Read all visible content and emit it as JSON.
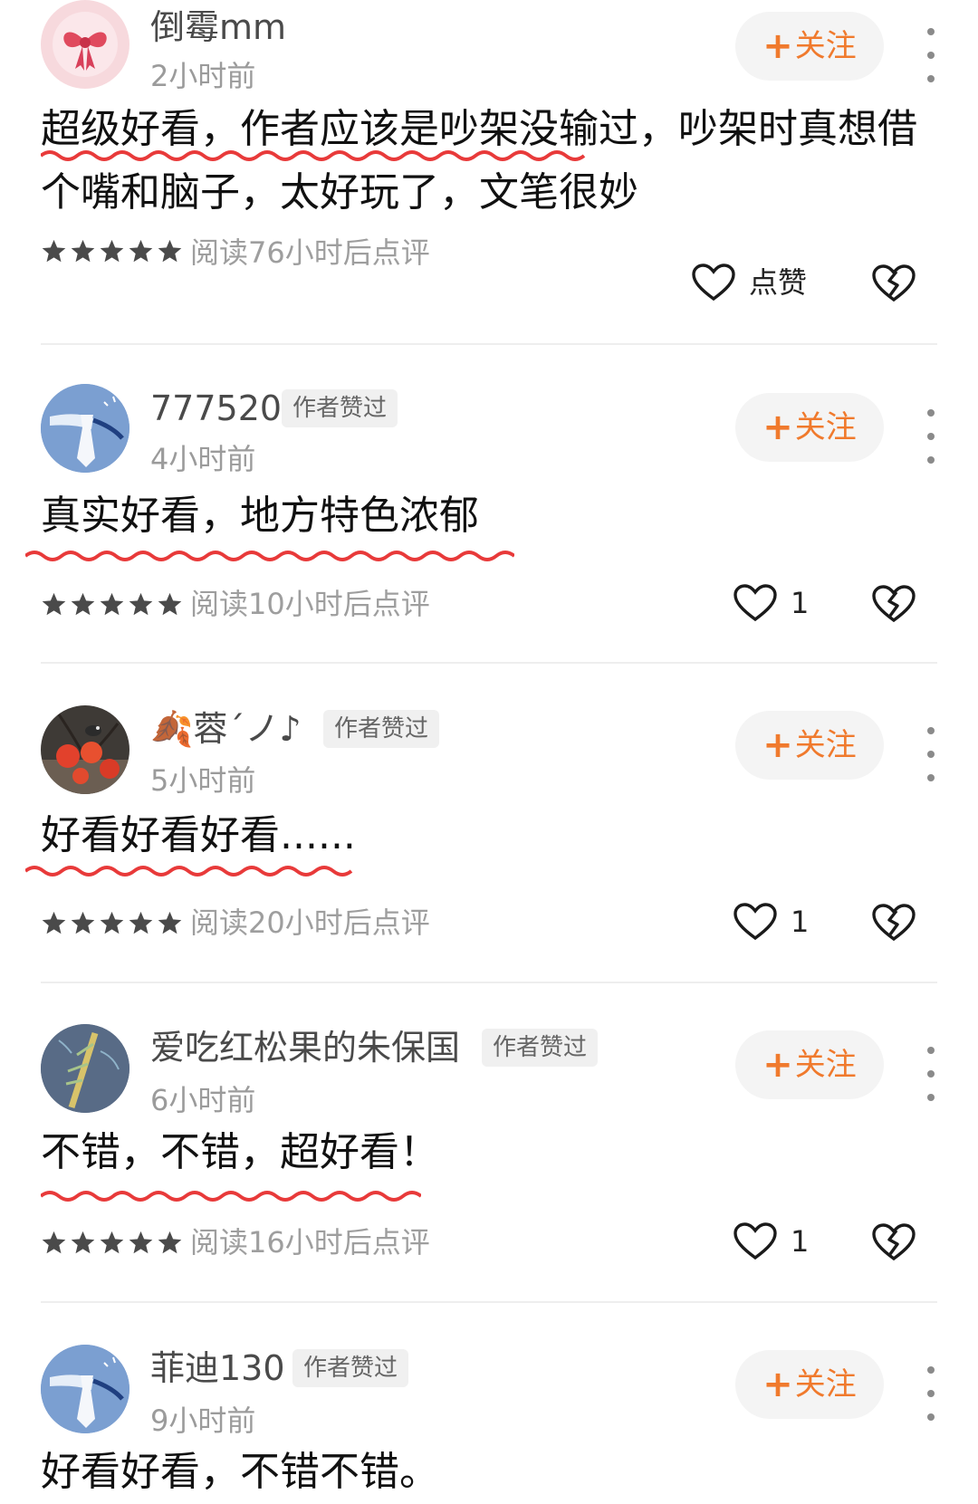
{
  "comments": [
    {
      "username": "倒霉mm",
      "time": "2小时前",
      "follow_label": "关注",
      "text_lines": [
        "超级好看，作者应该是吵架没输过，吵架时真想借",
        "个嘴和脑子，太好玩了，文笔很妙"
      ],
      "rating": 5,
      "read_time": "阅读76小时后点评",
      "like_label": "点赞",
      "avatar_icon": "bow-avatar-icon"
    },
    {
      "username": "777520",
      "badge": "作者赞过",
      "time": "4小时前",
      "follow_label": "关注",
      "text_lines": [
        "真实好看，地方特色浓郁"
      ],
      "rating": 5,
      "read_time": "阅读10小时后点评",
      "like_label": "1",
      "avatar_icon": "tie-avatar-icon"
    },
    {
      "username": "蓉´ノ♪",
      "badge": "作者赞过",
      "time": "5小时前",
      "follow_label": "关注",
      "text_lines": [
        "好看好看好看......"
      ],
      "rating": 5,
      "read_time": "阅读20小时后点评",
      "like_label": "1",
      "avatar_icon": "persimmon-bird-avatar-icon"
    },
    {
      "username": "爱吃红松果的朱保国",
      "badge": "作者赞过",
      "time": "6小时前",
      "follow_label": "关注",
      "text_lines": [
        "不错，不错，超好看！"
      ],
      "rating": 5,
      "read_time": "阅读16小时后点评",
      "like_label": "1",
      "avatar_icon": "bamboo-avatar-icon"
    },
    {
      "username": "菲迪130",
      "badge": "作者赞过",
      "time": "9小时前",
      "follow_label": "关注",
      "text_lines": [
        "好看好看，不错不错。"
      ],
      "avatar_icon": "tie-avatar-icon"
    }
  ],
  "colors": {
    "accent": "#f07a2d",
    "underline": "#e83a3a",
    "star": "#4a4a4a"
  }
}
